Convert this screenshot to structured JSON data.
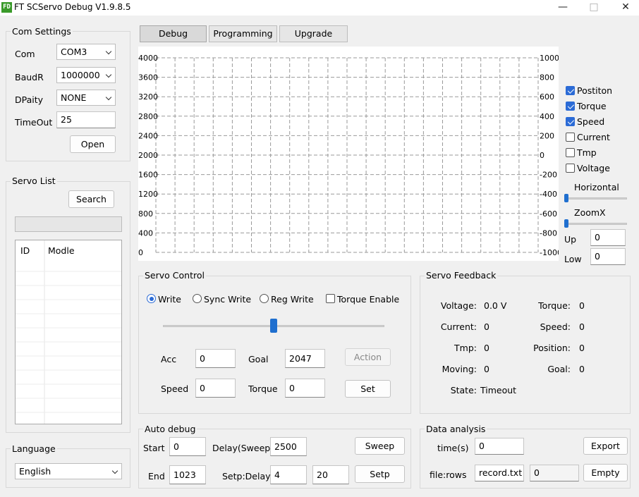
{
  "window": {
    "logo": "FD",
    "title": "FT SCServo Debug V1.9.8.5",
    "minimize": "—",
    "maximize": "□",
    "close": "✕"
  },
  "com": {
    "group_label": "Com Settings",
    "com_label": "Com",
    "com_value": "COM3",
    "baud_label": "BaudR",
    "baud_value": "1000000",
    "parity_label": "DPaity",
    "parity_value": "NONE",
    "timeout_label": "TimeOut",
    "timeout_value": "25",
    "open_label": "Open"
  },
  "servo_list": {
    "group_label": "Servo List",
    "search_label": "Search",
    "columns": [
      "ID",
      "Modle"
    ]
  },
  "language": {
    "group_label": "Language",
    "value": "English"
  },
  "tabs": [
    "Debug",
    "Programming",
    "Upgrade"
  ],
  "chart": {
    "left_ticks": [
      "4000",
      "3600",
      "3200",
      "2800",
      "2400",
      "2000",
      "1600",
      "1200",
      "800",
      "400",
      "0"
    ],
    "right_ticks": [
      "1000",
      "800",
      "600",
      "400",
      "200",
      "0",
      "-200",
      "-400",
      "-600",
      "-800",
      "-1000"
    ],
    "series": [
      {
        "name": "Postiton",
        "checked": true
      },
      {
        "name": "Torque",
        "checked": true
      },
      {
        "name": "Speed",
        "checked": true
      },
      {
        "name": "Current",
        "checked": false
      },
      {
        "name": "Tmp",
        "checked": false
      },
      {
        "name": "Voltage",
        "checked": false
      }
    ],
    "horizontal_label": "Horizontal",
    "zoomx_label": "ZoomX",
    "up_label": "Up",
    "up_value": "0",
    "low_label": "Low",
    "low_value": "0"
  },
  "servo_control": {
    "group_label": "Servo Control",
    "write": "Write",
    "sync_write": "Sync Write",
    "reg_write": "Reg Write",
    "torque_enable": "Torque Enable",
    "slider_fraction": 0.5,
    "acc_label": "Acc",
    "acc_value": "0",
    "goal_label": "Goal",
    "goal_value": "2047",
    "action_label": "Action",
    "speed_label": "Speed",
    "speed_value": "0",
    "torque_label": "Torque",
    "torque_value": "0",
    "set_label": "Set"
  },
  "servo_feedback": {
    "group_label": "Servo Feedback",
    "voltage_label": "Voltage:",
    "voltage_value": "0.0 V",
    "torque_label": "Torque:",
    "torque_value": "0",
    "current_label": "Current:",
    "current_value": "0",
    "speed_label": "Speed:",
    "speed_value": "0",
    "tmp_label": "Tmp:",
    "tmp_value": "0",
    "position_label": "Position:",
    "position_value": "0",
    "moving_label": "Moving:",
    "moving_value": "0",
    "goal_label": "Goal:",
    "goal_value": "0",
    "state_label": "State:",
    "state_value": "Timeout"
  },
  "auto_debug": {
    "group_label": "Auto debug",
    "start_label": "Start",
    "start_value": "0",
    "delay_label": "Delay(Sweep)",
    "delay_value": "2500",
    "sweep_label": "Sweep",
    "end_label": "End",
    "end_value": "1023",
    "setp_delay_label": "Setp:Delay",
    "setp_value": "4",
    "delay2_value": "20",
    "setp_label": "Setp"
  },
  "data_analysis": {
    "group_label": "Data analysis",
    "time_label": "time(s)",
    "time_value": "0",
    "export_label": "Export",
    "file_label": "file:rows",
    "file_value": "record.txt",
    "rows_value": "0",
    "empty_label": "Empty"
  }
}
